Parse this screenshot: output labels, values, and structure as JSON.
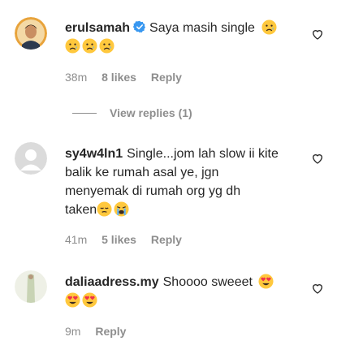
{
  "comments": [
    {
      "username": "erulsamah",
      "verified": true,
      "text": "Saya masih single",
      "emojis": [
        "sad-face-emoji",
        "sad-face-emoji",
        "sad-face-emoji",
        "sad-face-emoji"
      ],
      "time": "38m",
      "likes": "8 likes",
      "reply": "Reply"
    },
    {
      "username": "sy4w4ln1",
      "verified": false,
      "text_line1": "Single...jom lah slow ii kite",
      "text_line2": "balik ke rumah asal ye, jgn",
      "text_line3": "menyemak di rumah org yg dh",
      "text_line4": "taken",
      "emojis": [
        "pensive-face-emoji",
        "crying-face-emoji"
      ],
      "time": "41m",
      "likes": "5 likes",
      "reply": "Reply"
    },
    {
      "username": "daliaadress.my",
      "verified": false,
      "text": "Shoooo sweeet",
      "emojis": [
        "heart-eyes-emoji",
        "heart-eyes-emoji",
        "heart-eyes-emoji"
      ],
      "time": "9m",
      "reply": "Reply"
    }
  ],
  "view_replies": "View replies (1)",
  "colors": {
    "meta": "#8e8e8e",
    "verified": "#3897f0",
    "text": "#262626"
  }
}
